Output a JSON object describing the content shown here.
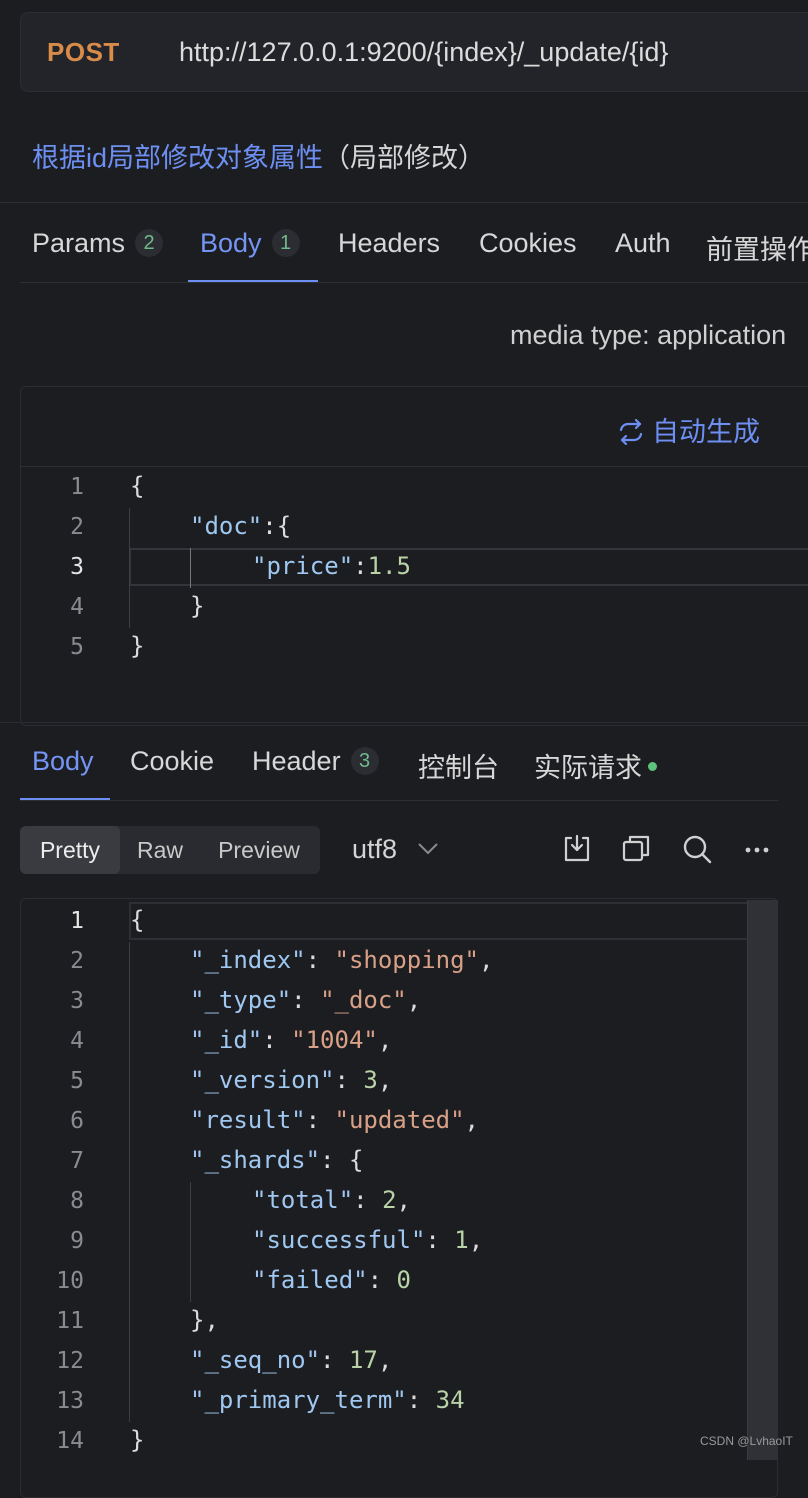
{
  "request": {
    "method": "POST",
    "url": "http://127.0.0.1:9200/{index}/_update/{id}",
    "description": "根据id局部修改对象属性",
    "description_note": "（局部修改）"
  },
  "request_tabs": [
    {
      "label": "Params",
      "badge": "2"
    },
    {
      "label": "Body",
      "badge": "1",
      "active": true
    },
    {
      "label": "Headers"
    },
    {
      "label": "Cookies"
    },
    {
      "label": "Auth"
    },
    {
      "label": "前置操作"
    }
  ],
  "media_type": "media type: application",
  "auto_generate": "自动生成",
  "request_body": {
    "line_numbers": [
      "1",
      "2",
      "3",
      "4",
      "5"
    ],
    "tokens": {
      "l1": "{",
      "l2_key": "\"doc\"",
      "l2_rest": ":{",
      "l3_key": "\"price\"",
      "l3_colon": ":",
      "l3_val": "1.5",
      "l4": "}",
      "l5": "}"
    }
  },
  "response_tabs": [
    {
      "label": "Body",
      "active": true
    },
    {
      "label": "Cookie"
    },
    {
      "label": "Header",
      "badge": "3"
    },
    {
      "label": "控制台"
    },
    {
      "label": "实际请求",
      "dot": true
    }
  ],
  "view_modes": [
    "Pretty",
    "Raw",
    "Preview"
  ],
  "encoding": "utf8",
  "response_body": {
    "line_numbers": [
      "1",
      "2",
      "3",
      "4",
      "5",
      "6",
      "7",
      "8",
      "9",
      "10",
      "11",
      "12",
      "13",
      "14"
    ],
    "lines": [
      {
        "open": "{"
      },
      {
        "key": "\"_index\"",
        "str": "\"shopping\"",
        "tail": ","
      },
      {
        "key": "\"_type\"",
        "str": "\"_doc\"",
        "tail": ","
      },
      {
        "key": "\"_id\"",
        "str": "\"1004\"",
        "tail": ","
      },
      {
        "key": "\"_version\"",
        "num": "3",
        "tail": ","
      },
      {
        "key": "\"result\"",
        "str": "\"updated\"",
        "tail": ","
      },
      {
        "key": "\"_shards\"",
        "tail": "{"
      },
      {
        "key": "\"total\"",
        "num": "2",
        "tail": ","
      },
      {
        "key": "\"successful\"",
        "num": "1",
        "tail": ","
      },
      {
        "key": "\"failed\"",
        "num": "0"
      },
      {
        "close": "},"
      },
      {
        "key": "\"_seq_no\"",
        "num": "17",
        "tail": ","
      },
      {
        "key": "\"_primary_term\"",
        "num": "34"
      },
      {
        "close": "}"
      }
    ]
  },
  "watermark": "CSDN @LvhaoIT",
  "colors": {
    "accent": "#6d8ff2",
    "method": "#d98b4a",
    "json_key": "#9fc7f0",
    "json_string": "#d8a086",
    "json_number": "#b9d2a8",
    "badge_text": "#6fb98a",
    "status_dot": "#5cc27e"
  }
}
